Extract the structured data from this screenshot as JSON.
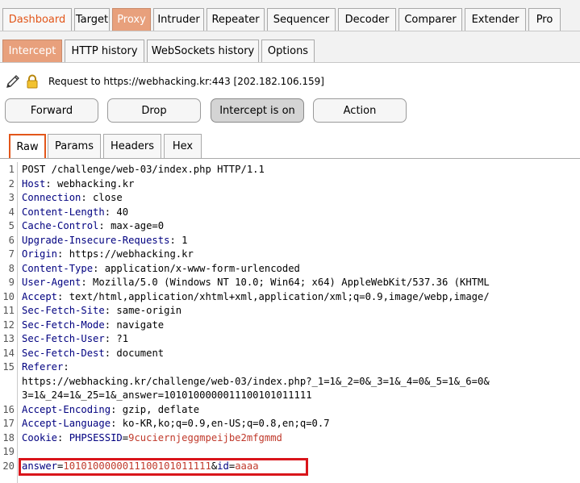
{
  "main_tabs": [
    "Dashboard",
    "Target",
    "Proxy",
    "Intruder",
    "Repeater",
    "Sequencer",
    "Decoder",
    "Comparer",
    "Extender",
    "Pro"
  ],
  "sub_tabs": [
    "Intercept",
    "HTTP history",
    "WebSockets history",
    "Options"
  ],
  "request_label": "Request to https://webhacking.kr:443  [202.182.106.159]",
  "buttons": {
    "forward": "Forward",
    "drop": "Drop",
    "intercept": "Intercept is on",
    "action": "Action"
  },
  "view_tabs": [
    "Raw",
    "Params",
    "Headers",
    "Hex"
  ],
  "colors": {
    "accent": "#e2561a",
    "highlight_box": "#d9151b",
    "header_key": "#000080",
    "param_value": "#c0392b"
  },
  "icons": {
    "edit": "pencil-icon",
    "lock": "lock-icon"
  },
  "request_lines": [
    {
      "num": "1",
      "text": "POST /challenge/web-03/index.php HTTP/1.1"
    },
    {
      "num": "2",
      "key": "Host",
      "value": " webhacking.kr"
    },
    {
      "num": "3",
      "key": "Connection",
      "value": " close"
    },
    {
      "num": "4",
      "key": "Content-Length",
      "value": " 40"
    },
    {
      "num": "5",
      "key": "Cache-Control",
      "value": " max-age=0"
    },
    {
      "num": "6",
      "key": "Upgrade-Insecure-Requests",
      "value": " 1"
    },
    {
      "num": "7",
      "key": "Origin",
      "value": " https://webhacking.kr"
    },
    {
      "num": "8",
      "key": "Content-Type",
      "value": " application/x-www-form-urlencoded"
    },
    {
      "num": "9",
      "key": "User-Agent",
      "value": " Mozilla/5.0 (Windows NT 10.0; Win64; x64) AppleWebKit/537.36 (KHTML"
    },
    {
      "num": "10",
      "key": "Accept",
      "value": " text/html,application/xhtml+xml,application/xml;q=0.9,image/webp,image/"
    },
    {
      "num": "11",
      "key": "Sec-Fetch-Site",
      "value": " same-origin"
    },
    {
      "num": "12",
      "key": "Sec-Fetch-Mode",
      "value": " navigate"
    },
    {
      "num": "13",
      "key": "Sec-Fetch-User",
      "value": " ?1"
    },
    {
      "num": "14",
      "key": "Sec-Fetch-Dest",
      "value": " document"
    },
    {
      "num": "15",
      "key": "Referer",
      "value": ""
    },
    {
      "num": "",
      "text": "https://webhacking.kr/challenge/web-03/index.php?_1=1&_2=0&_3=1&_4=0&_5=1&_6=0&"
    },
    {
      "num": "",
      "text": "3=1&_24=1&_25=1&_answer=1010100000011100101011111"
    },
    {
      "num": "16",
      "key": "Accept-Encoding",
      "value": " gzip, deflate"
    },
    {
      "num": "17",
      "key": "Accept-Language",
      "value": " ko-KR,ko;q=0.9,en-US;q=0.8,en;q=0.7"
    },
    {
      "num": "18",
      "key": "Cookie",
      "value": " ",
      "ck": "PHPSESSID",
      "cv": "9cuciernjeggmpeijbe2mfgmmd"
    },
    {
      "num": "19",
      "text": ""
    },
    {
      "num": "20",
      "body": [
        {
          "k": "answer",
          "v": "1010100000011100101011111"
        },
        {
          "k": "id",
          "v": "aaaa"
        }
      ]
    }
  ]
}
